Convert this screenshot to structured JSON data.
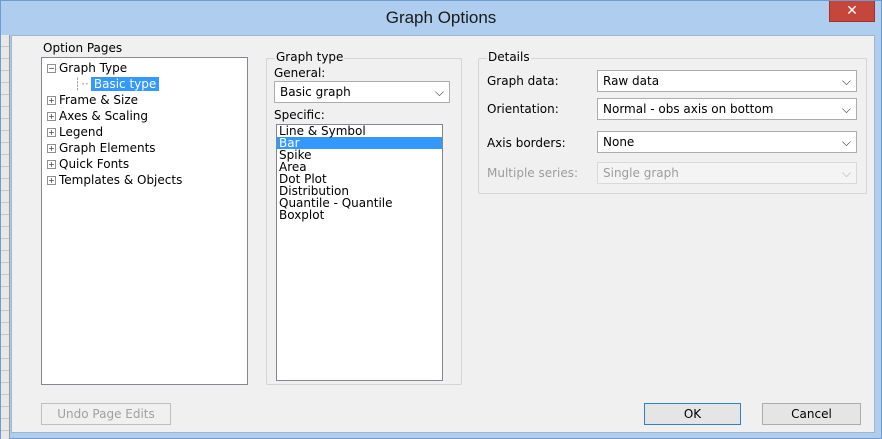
{
  "window": {
    "title": "Graph Options",
    "close_glyph": "✕"
  },
  "option_pages": {
    "label": "Option Pages",
    "tree": [
      {
        "label": "Graph Type",
        "expander": "−"
      },
      {
        "label": "Basic type",
        "selected": true
      },
      {
        "label": "Frame & Size",
        "expander": "+"
      },
      {
        "label": "Axes & Scaling",
        "expander": "+"
      },
      {
        "label": "Legend",
        "expander": "+"
      },
      {
        "label": "Graph Elements",
        "expander": "+"
      },
      {
        "label": "Quick Fonts",
        "expander": "+"
      },
      {
        "label": "Templates & Objects",
        "expander": "+"
      }
    ]
  },
  "graph_type": {
    "label": "Graph type",
    "general_label": "General:",
    "general_value": "Basic graph",
    "specific_label": "Specific:",
    "specific_items": [
      "Line & Symbol",
      "Bar",
      "Spike",
      "Area",
      "Dot Plot",
      "Distribution",
      "Quantile - Quantile",
      "Boxplot"
    ],
    "specific_selected": "Bar"
  },
  "details": {
    "label": "Details",
    "graph_data_label": "Graph data:",
    "graph_data_value": "Raw data",
    "orientation_label": "Orientation:",
    "orientation_value": "Normal - obs axis on bottom",
    "axis_borders_label": "Axis borders:",
    "axis_borders_value": "None",
    "multiple_series_label": "Multiple series:",
    "multiple_series_value": "Single graph"
  },
  "footer": {
    "undo_label": "Undo Page Edits",
    "ok_label": "OK",
    "cancel_label": "Cancel"
  },
  "icons": {
    "dropdown": "chevron-down-icon",
    "close": "close-icon"
  },
  "colors": {
    "selection": "#3399ff",
    "titlebar": "#aecdef",
    "close": "#c7463b"
  }
}
